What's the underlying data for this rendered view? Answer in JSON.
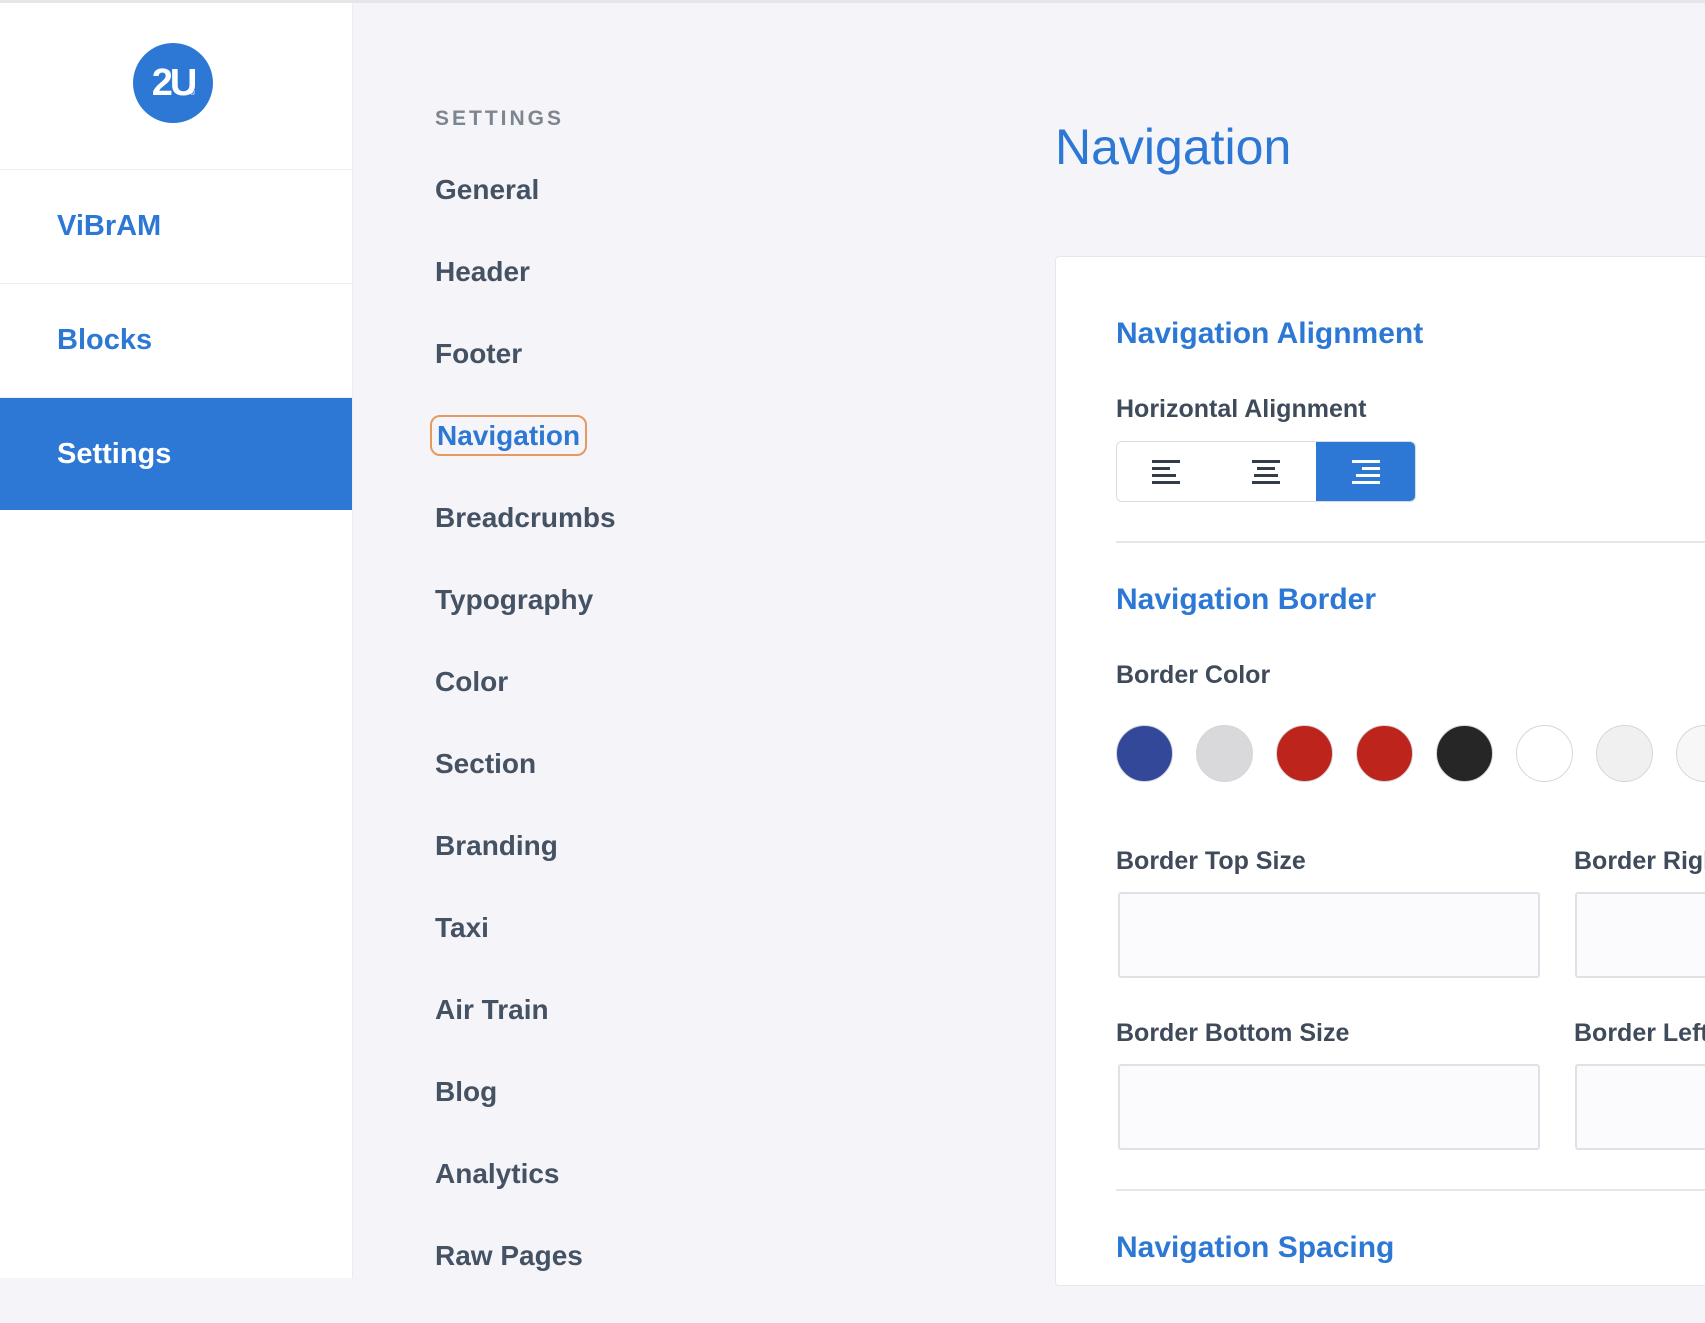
{
  "sidebar": {
    "logo_text": "2U",
    "logo_mark": "®",
    "items": [
      {
        "label": "ViBrAM"
      },
      {
        "label": "Blocks"
      },
      {
        "label": "Settings"
      }
    ]
  },
  "subnav": {
    "heading": "SETTINGS",
    "items": [
      {
        "label": "General"
      },
      {
        "label": "Header"
      },
      {
        "label": "Footer"
      },
      {
        "label": "Navigation"
      },
      {
        "label": "Breadcrumbs"
      },
      {
        "label": "Typography"
      },
      {
        "label": "Color"
      },
      {
        "label": "Section"
      },
      {
        "label": "Branding"
      },
      {
        "label": "Taxi"
      },
      {
        "label": "Air Train"
      },
      {
        "label": "Blog"
      },
      {
        "label": "Analytics"
      },
      {
        "label": "Raw Pages"
      }
    ],
    "active": "Navigation"
  },
  "page": {
    "title": "Navigation"
  },
  "alignment": {
    "section_title": "Navigation Alignment",
    "label": "Horizontal Alignment",
    "options": [
      "align-left-icon",
      "align-center-icon",
      "align-right-icon"
    ],
    "selected": "right"
  },
  "border": {
    "section_title": "Navigation Border",
    "color_label": "Border Color",
    "colors": [
      "#34489a",
      "#d9d8da",
      "#bd241c",
      "#bd241c",
      "#262626",
      "#ffffff",
      "#f0f0f0",
      "#f7f7f7"
    ],
    "top_size_label": "Border Top Size",
    "right_size_label": "Border Righ",
    "bottom_size_label": "Border Bottom Size",
    "left_size_label": "Border Left",
    "top_size_value": "",
    "right_size_value": "",
    "bottom_size_value": "",
    "left_size_value": ""
  },
  "spacing": {
    "section_title": "Navigation Spacing"
  },
  "colors": {
    "accent": "#2c78d4",
    "focus_ring": "#e59a62"
  }
}
